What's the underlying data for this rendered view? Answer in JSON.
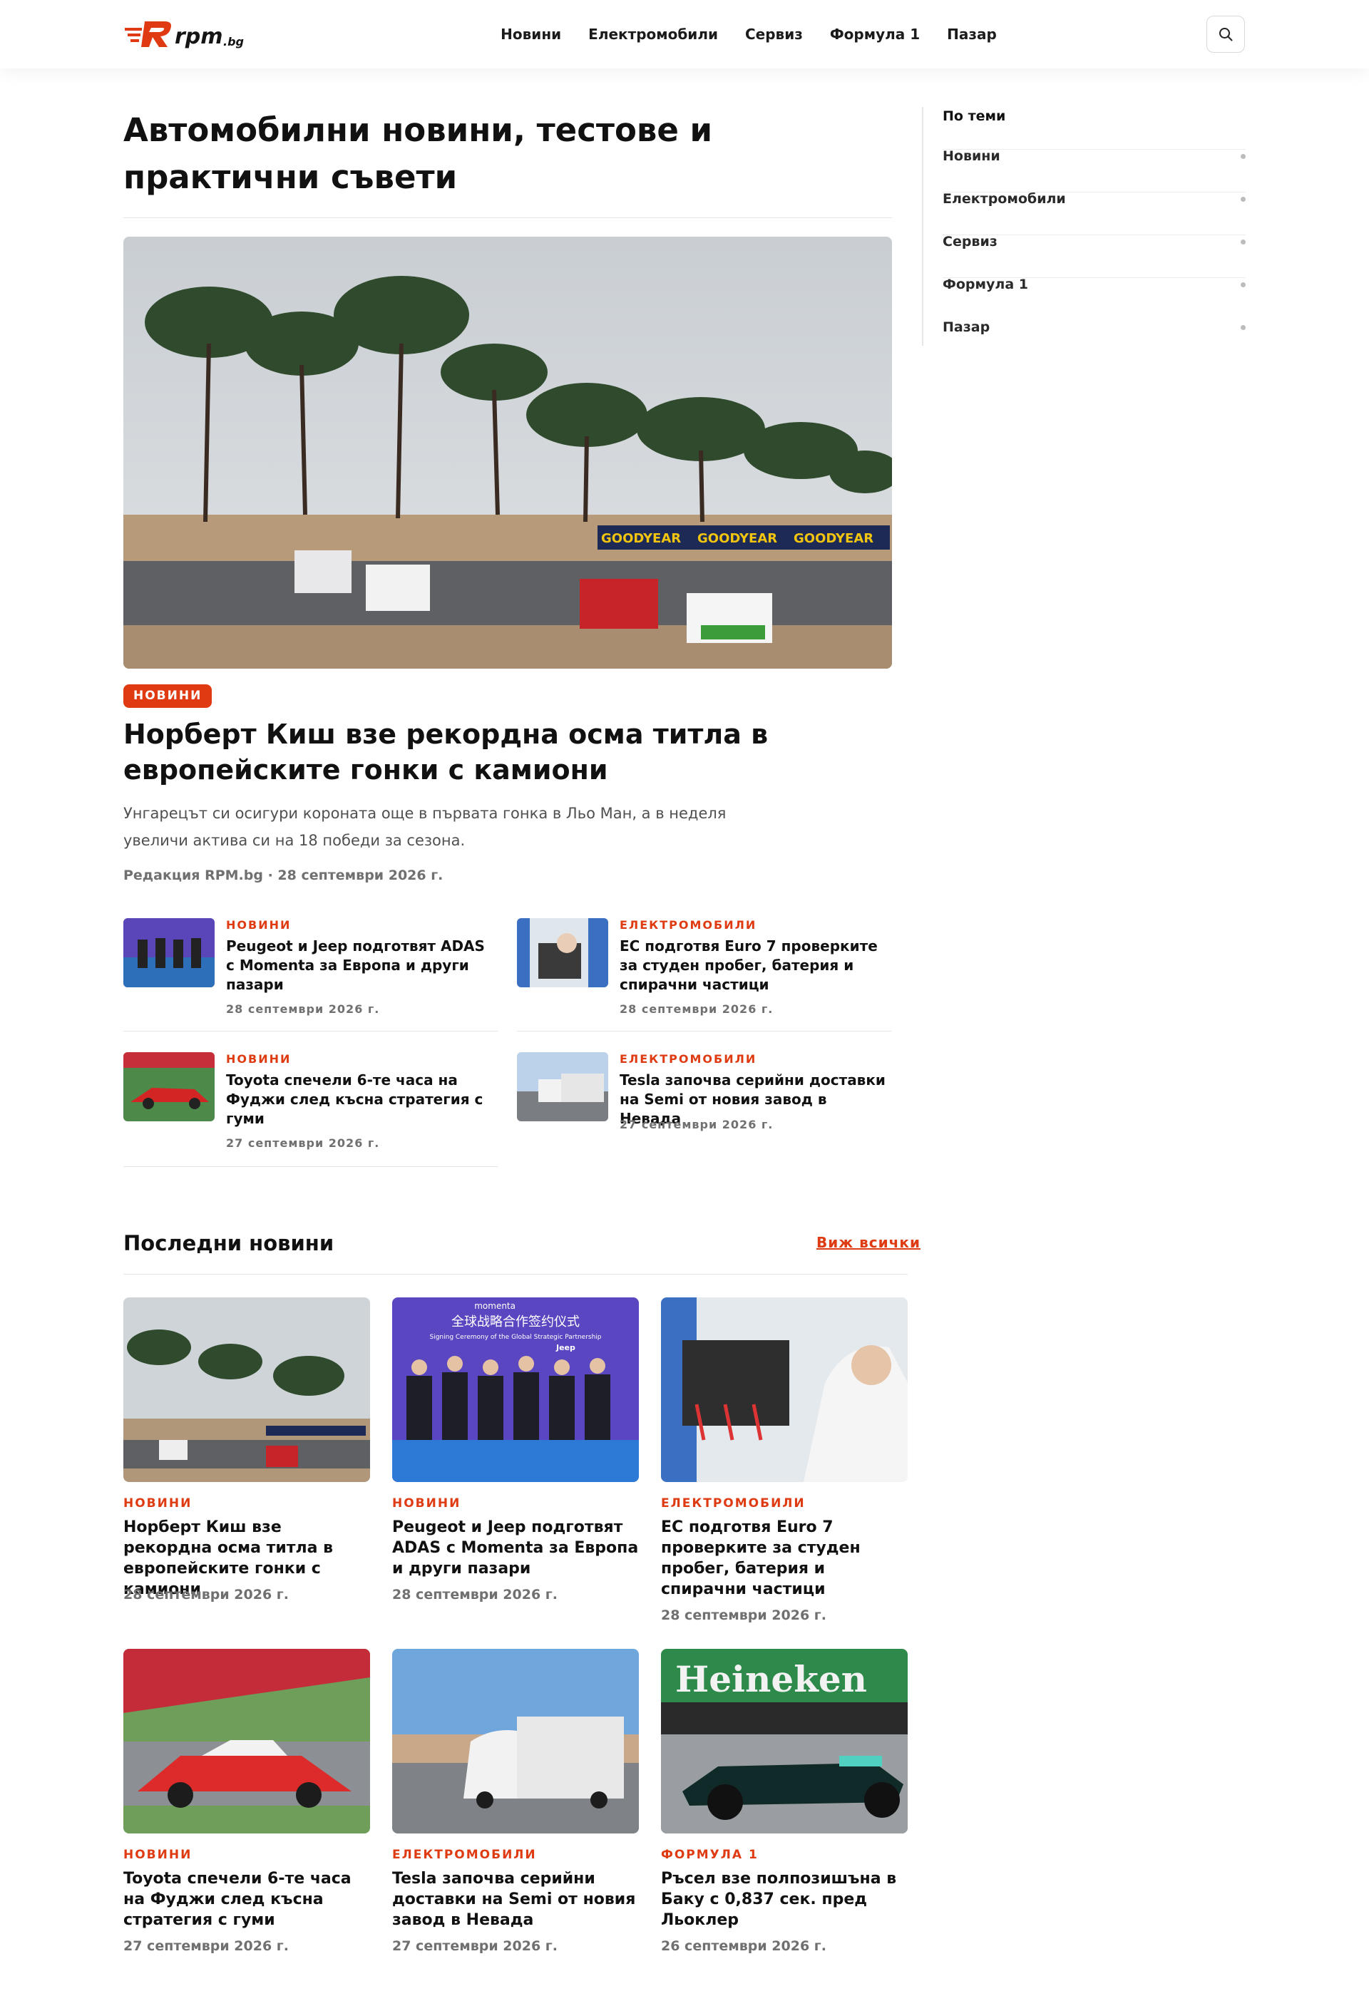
{
  "brand": {
    "name": "rpm",
    "domain_suffix": ".bg",
    "accent": "#e03a12"
  },
  "nav": [
    "Новини",
    "Електромобили",
    "Сервиз",
    "Формула 1",
    "Пазар"
  ],
  "search": {
    "icon": "search-icon"
  },
  "page_title": "Автомобилни новини, тестове и практични съвети",
  "hero": {
    "category": "НОВИНИ",
    "title": "Норберт Киш взе рекордна осма титла в европейските гонки с камиони",
    "excerpt": "Унгарецът си осигури короната още в първата гонка в Льо Ман, а в неделя увеличи актива си на 18 победи за сезона.",
    "meta": "Редакция RPM.bg · 28 септември 2026 г.",
    "banner_text": "GOODYEAR"
  },
  "mini_list": [
    {
      "category": "НОВИНИ",
      "title": "Peugeot и Jeep подготвят ADAS с Momenta за Европа и други пазари",
      "date": "28 септември 2026 г."
    },
    {
      "category": "ЕЛЕКТРОМОБИЛИ",
      "title": "ЕС подготвя Euro 7 проверките за студен пробег, батерия и спирачни частици",
      "date": "28 септември 2026 г."
    },
    {
      "category": "НОВИНИ",
      "title": "Toyota спечели 6-те часа на Фуджи след късна стратегия с гуми",
      "date": "27 септември 2026 г."
    },
    {
      "category": "ЕЛЕКТРОМОБИЛИ",
      "title": "Tesla започва серийни доставки на Semi от новия завод в Невада",
      "date": "27 септември 2026 г."
    }
  ],
  "latest": {
    "heading": "Последни новини",
    "see_all": "Виж всички",
    "cards": [
      {
        "category": "НОВИНИ",
        "title": "Норберт Киш взе рекордна осма титла в европейските гонки с камиони",
        "date": "28 септември 2026 г."
      },
      {
        "category": "НОВИНИ",
        "title": "Peugeot и Jeep подготвят ADAS с Momenta за Европа и други пазари",
        "date": "28 септември 2026 г."
      },
      {
        "category": "ЕЛЕКТРОМОБИЛИ",
        "title": "ЕС подготвя Euro 7 проверките за студен пробег, батерия и спирачни частици",
        "date": "28 септември 2026 г."
      },
      {
        "category": "НОВИНИ",
        "title": "Toyota спечели 6-те часа на Фуджи след късна стратегия с гуми",
        "date": "27 септември 2026 г."
      },
      {
        "category": "ЕЛЕКТРОМОБИЛИ",
        "title": "Tesla започва серийни доставки на Semi от новия завод в Невада",
        "date": "27 септември 2026 г."
      },
      {
        "category": "ФОРМУЛА 1",
        "title": "Ръсел взе полпозишъна в Баку с 0,837 сек. пред Льоклер",
        "date": "26 септември 2026 г."
      }
    ],
    "image_texts": {
      "ceremony_cn": "全球战略合作签约仪式",
      "ceremony_en": "Signing Ceremony of the Global Strategic Partnership",
      "momenta": "momenta",
      "jeep": "Jeep",
      "heineken": "Heineken"
    }
  },
  "sidebar": {
    "heading": "По теми",
    "items": [
      "Новини",
      "Електромобили",
      "Сервиз",
      "Формула 1",
      "Пазар"
    ]
  }
}
